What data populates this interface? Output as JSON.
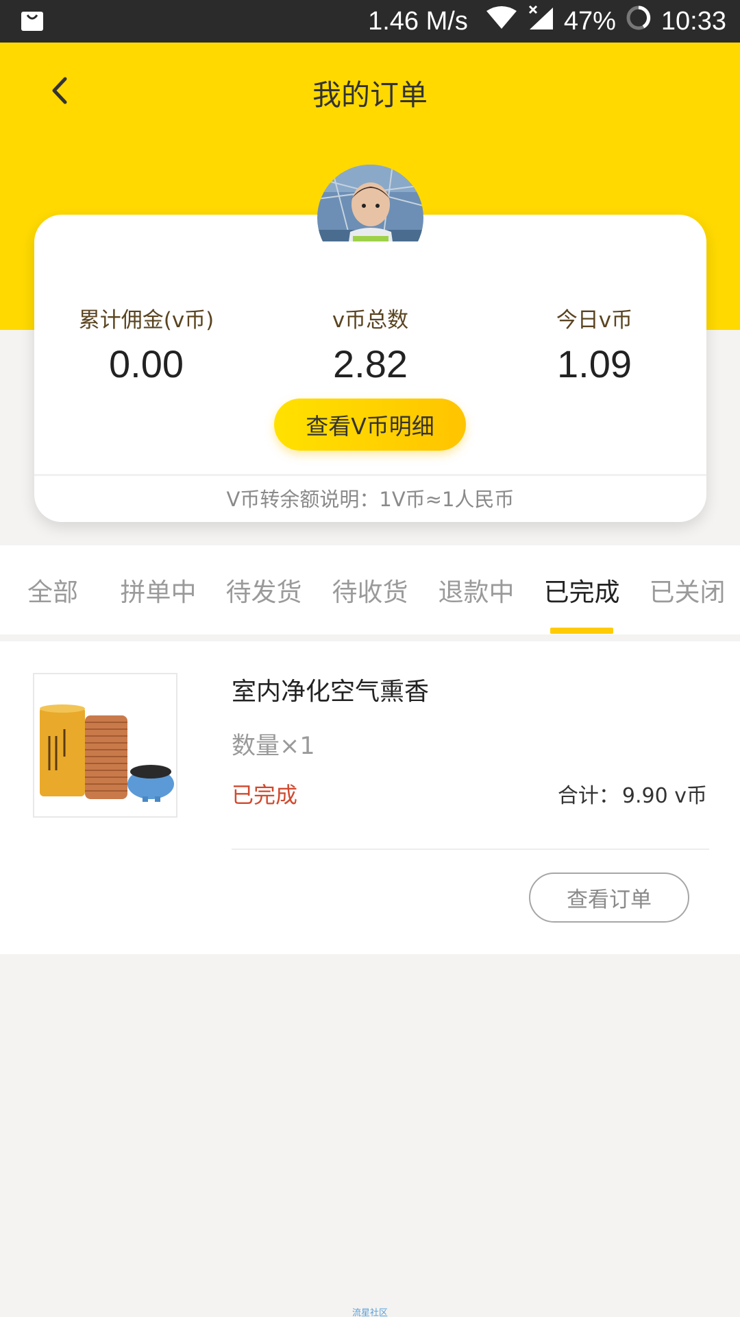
{
  "status_bar": {
    "speed": "1.46 M/s",
    "battery": "47%",
    "time": "10:33"
  },
  "header": {
    "title": "我的订单"
  },
  "stats": [
    {
      "label": "累计佣金(v币)",
      "value": "0.00"
    },
    {
      "label": "v币总数",
      "value": "2.82"
    },
    {
      "label": "今日v币",
      "value": "1.09"
    }
  ],
  "detail_button": "查看V币明细",
  "note": "V币转余额说明：1V币≈1人民币",
  "tabs": [
    {
      "label": "全部"
    },
    {
      "label": "拼单中"
    },
    {
      "label": "待发货"
    },
    {
      "label": "待收货"
    },
    {
      "label": "退款中"
    },
    {
      "label": "已完成"
    },
    {
      "label": "已关闭"
    }
  ],
  "active_tab": "已完成",
  "order": {
    "product_name": "室内净化空气熏香",
    "quantity": "数量×1",
    "status": "已完成",
    "total_label": "合计：",
    "total_value": "9.90 v币",
    "view_button": "查看订单"
  },
  "watermark": "流星社区",
  "colors": {
    "header_yellow": "#ffd900",
    "accent_yellow": "#ffcb05",
    "status_red": "#d04a2f"
  }
}
